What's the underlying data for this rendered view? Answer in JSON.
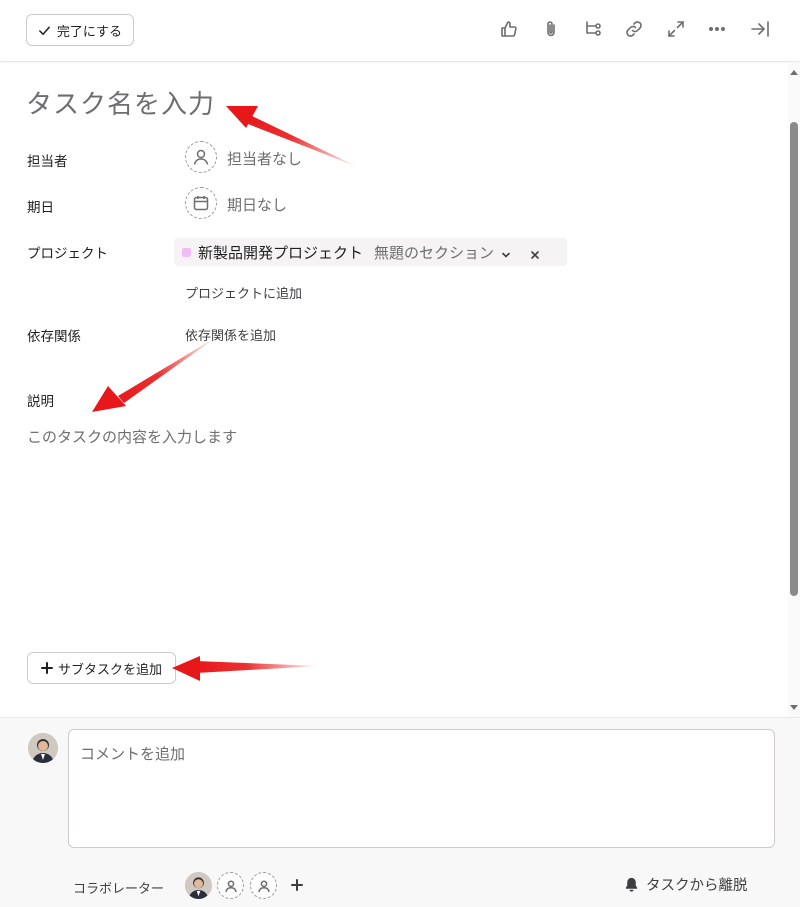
{
  "toolbar": {
    "complete_label": "完了にする",
    "icons": [
      "thumbs-up-icon",
      "paperclip-icon",
      "subtask-icon",
      "link-icon",
      "expand-icon",
      "more-icon",
      "close-pane-icon"
    ]
  },
  "task": {
    "title_placeholder": "タスク名を入力"
  },
  "fields": {
    "assignee": {
      "label": "担当者",
      "value": "担当者なし"
    },
    "due_date": {
      "label": "期日",
      "value": "期日なし"
    },
    "project": {
      "label": "プロジェクト",
      "project_name": "新製品開発プロジェクト",
      "section_name": "無題のセクション",
      "add_link": "プロジェクトに追加",
      "dot_color": "#f1bdf8"
    },
    "dependencies": {
      "label": "依存関係",
      "add_link": "依存関係を追加"
    },
    "description": {
      "label": "説明",
      "placeholder": "このタスクの内容を入力します"
    }
  },
  "subtask": {
    "add_label": "サブタスクを追加"
  },
  "comment": {
    "placeholder": "コメントを追加"
  },
  "collaborators": {
    "label": "コラボレーター"
  },
  "leave": {
    "label": "タスクから離脱"
  },
  "colors": {
    "annotation_arrow": "#e8181a",
    "scrollbar_thumb": "#8a8a8a"
  }
}
